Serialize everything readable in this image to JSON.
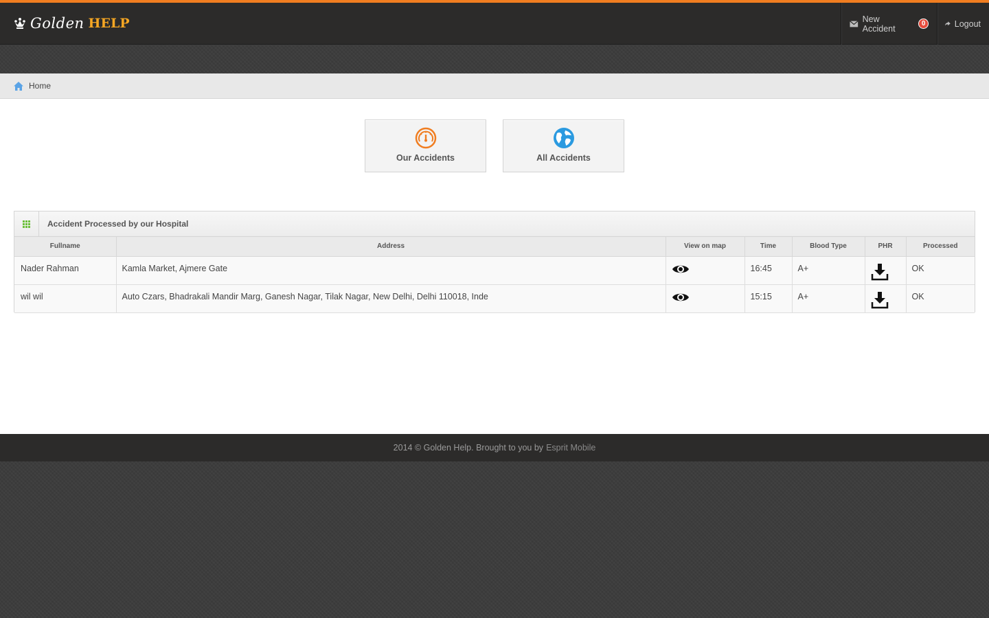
{
  "brand": {
    "part1": "Golden",
    "part2": "HELP"
  },
  "nav": {
    "new_accident_label": "New Accident",
    "new_accident_count": "0",
    "logout_label": "Logout"
  },
  "breadcrumb": {
    "home": "Home"
  },
  "shortcuts": [
    {
      "label": "Our Accidents",
      "icon": "dashboard-icon",
      "color": "#f07d20"
    },
    {
      "label": "All Accidents",
      "icon": "globe-icon",
      "color": "#2b9ae0"
    }
  ],
  "widget": {
    "title": "Accident Processed by our Hospital",
    "columns": [
      "Fullname",
      "Address",
      "View on map",
      "Time",
      "Blood Type",
      "PHR",
      "Processed"
    ],
    "rows": [
      {
        "fullname": "Nader Rahman",
        "address": "Kamla Market, Ajmere Gate",
        "time": "16:45",
        "blood": "A+",
        "processed": "OK"
      },
      {
        "fullname": "wil wil",
        "address": "Auto Czars, Bhadrakali Mandir Marg, Ganesh Nagar, Tilak Nagar, New Delhi, Delhi 110018, Inde",
        "time": "15:15",
        "blood": "A+",
        "processed": "OK"
      }
    ]
  },
  "footer": {
    "text": "2014 © Golden Help. Brought to you by",
    "link": "Esprit Mobile"
  },
  "colors": {
    "accent": "#f07d20",
    "badge": "#e74c3c",
    "brand_help": "#f5a623"
  }
}
